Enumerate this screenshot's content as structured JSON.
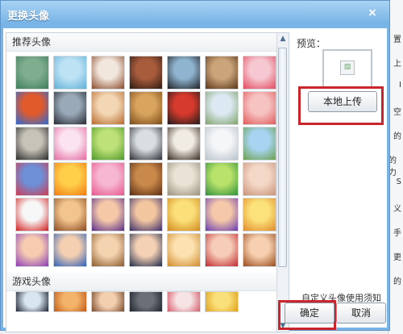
{
  "dialog": {
    "title": "更换头像",
    "close_label": "×"
  },
  "sections": [
    {
      "label": "推荐头像"
    },
    {
      "label": "游戏头像"
    }
  ],
  "preview": {
    "label": "预览：",
    "image_placeholder": "▧"
  },
  "buttons": {
    "upload": "本地上传",
    "ok": "确定",
    "cancel": "取消"
  },
  "notice_text": "自定义头像使用须知",
  "background_right_chars": [
    "置",
    "上",
    "I",
    "空",
    "的",
    "的力",
    "S",
    "义",
    "手",
    "更",
    "的"
  ],
  "avatars": [
    {
      "name": "silhouette-face",
      "c1": "#7fae8f",
      "c2": "#3f7d5a"
    },
    {
      "name": "happy-face-sky",
      "c1": "#bde2f4",
      "c2": "#5fb0d8"
    },
    {
      "name": "coffee-cup",
      "c1": "#f2e7dc",
      "c2": "#8a4a2c"
    },
    {
      "name": "opera-mask-woman",
      "c1": "#a85c3c",
      "c2": "#2d1a12"
    },
    {
      "name": "penguin",
      "c1": "#8fb4cf",
      "c2": "#1d1f24"
    },
    {
      "name": "latte-art",
      "c1": "#caa57a",
      "c2": "#5b3518"
    },
    {
      "name": "pink-sheep",
      "c1": "#f6c9d2",
      "c2": "#e2485e"
    },
    {
      "name": "color-pencils",
      "c1": "#e15a2b",
      "c2": "#2b6bd6"
    },
    {
      "name": "graduation-cap",
      "c1": "#9aa9b8",
      "c2": "#262a33"
    },
    {
      "name": "chef-cartoon",
      "c1": "#f3d7b5",
      "c2": "#b86a2c"
    },
    {
      "name": "pastries",
      "c1": "#d9a45d",
      "c2": "#7c4a18"
    },
    {
      "name": "peking-opera-mask",
      "c1": "#d63a2c",
      "c2": "#1e1b1b"
    },
    {
      "name": "hummingbird",
      "c1": "#dce9f2",
      "c2": "#7fa36a"
    },
    {
      "name": "ghost-pink",
      "c1": "#f7c2c2",
      "c2": "#e05a5a"
    },
    {
      "name": "penguins-group",
      "c1": "#c7c3b8",
      "c2": "#2a2a2a"
    },
    {
      "name": "pink-donut",
      "c1": "#fbe3ef",
      "c2": "#e46aa2"
    },
    {
      "name": "green-grass",
      "c1": "#bfe17a",
      "c2": "#4e9a2a"
    },
    {
      "name": "baby-penguin",
      "c1": "#d9dee3",
      "c2": "#2c2f34"
    },
    {
      "name": "dog-face",
      "c1": "#f0ece4",
      "c2": "#3b2a1f"
    },
    {
      "name": "white-cat",
      "c1": "#f4f6f8",
      "c2": "#b9c2cb"
    },
    {
      "name": "grassland-sky",
      "c1": "#a8d4f2",
      "c2": "#6aa04a"
    },
    {
      "name": "opera-costume",
      "c1": "#6d8fd6",
      "c2": "#d13a52"
    },
    {
      "name": "orange-flower",
      "c1": "#ffcf4a",
      "c2": "#f07a12"
    },
    {
      "name": "pink-petals",
      "c1": "#f7b7d1",
      "c2": "#e7568f"
    },
    {
      "name": "violin",
      "c1": "#c9894a",
      "c2": "#5a2d12"
    },
    {
      "name": "open-book",
      "c1": "#eae3d5",
      "c2": "#9a8f7c"
    },
    {
      "name": "green-circles",
      "c1": "#b8e26a",
      "c2": "#2f8f3a"
    },
    {
      "name": "baby-face",
      "c1": "#f4d8c7",
      "c2": "#c9927a"
    },
    {
      "name": "qq-penguin",
      "c1": "#f7f7f7",
      "c2": "#d21f1f"
    },
    {
      "name": "anime-boy-brown",
      "c1": "#f2c48e",
      "c2": "#8b4a1f"
    },
    {
      "name": "anime-boy-purple",
      "c1": "#f5c9a8",
      "c2": "#5a2d8a"
    },
    {
      "name": "anime-boy-hat",
      "c1": "#f2c7a0",
      "c2": "#3a2b6a"
    },
    {
      "name": "anime-girl-blonde",
      "c1": "#fbe07a",
      "c2": "#d18a1a"
    },
    {
      "name": "anime-boy-purple-hair",
      "c1": "#f4c8a8",
      "c2": "#6a3ab0"
    },
    {
      "name": "anime-girl-blonde-2",
      "c1": "#fbe27a",
      "c2": "#e08a2a"
    },
    {
      "name": "anime-girl-purple",
      "c1": "#f6cbb0",
      "c2": "#8a3ab8"
    },
    {
      "name": "anime-boy-blue",
      "c1": "#f4cfb0",
      "c2": "#2b5fb8"
    },
    {
      "name": "anime-girl-brown",
      "c1": "#f4d3b0",
      "c2": "#8a5a2a"
    },
    {
      "name": "anime-girl-dark",
      "c1": "#f4d0b4",
      "c2": "#1f2a4a"
    },
    {
      "name": "anime-girl-wink",
      "c1": "#fbe2b0",
      "c2": "#d18a2a"
    },
    {
      "name": "anime-girl-red",
      "c1": "#f6cdb8",
      "c2": "#c0282f"
    },
    {
      "name": "anime-girl-brown-2",
      "c1": "#f6d0b0",
      "c2": "#9a4a1a"
    },
    {
      "name": "game-penguin",
      "c1": "#d8e6f2",
      "c2": "#1d2430"
    },
    {
      "name": "game-orange",
      "c1": "#f3b46a",
      "c2": "#c25a18"
    },
    {
      "name": "game-face",
      "c1": "#f3cfb0",
      "c2": "#7a4a2a"
    },
    {
      "name": "game-dark",
      "c1": "#6a6f78",
      "c2": "#1f232a"
    },
    {
      "name": "game-nurse",
      "c1": "#f6e4e4",
      "c2": "#d85a6a"
    },
    {
      "name": "game-yellow",
      "c1": "#fae07a",
      "c2": "#e0a01a"
    }
  ]
}
